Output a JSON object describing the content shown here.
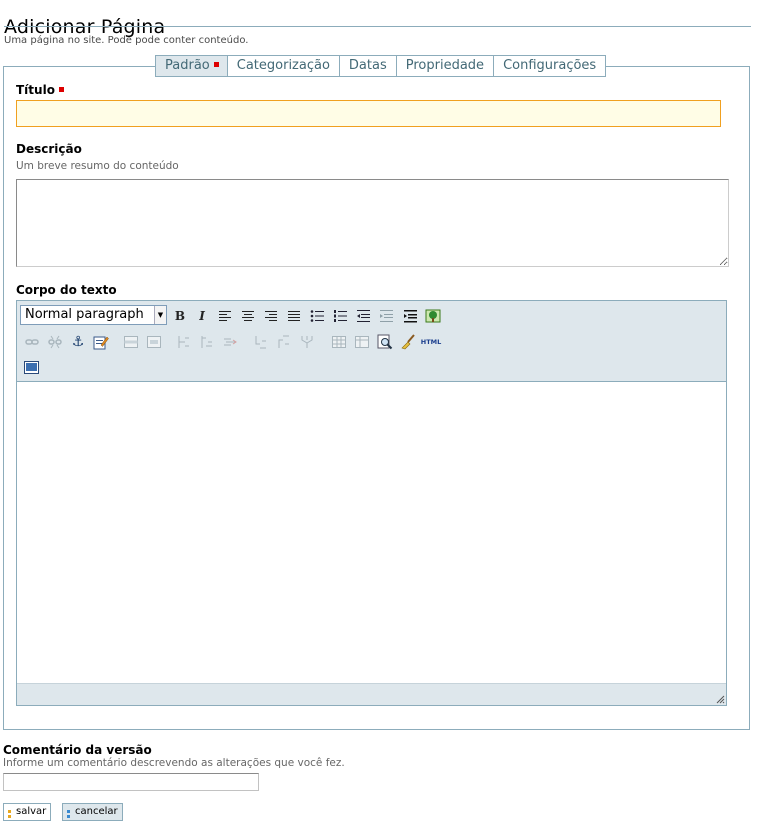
{
  "page": {
    "title": "Adicionar Página",
    "description": "Uma página no site. Pode pode conter conteúdo."
  },
  "tabs": [
    {
      "label": "Padrão",
      "active": true
    },
    {
      "label": "Categorização"
    },
    {
      "label": "Datas"
    },
    {
      "label": "Propriedade"
    },
    {
      "label": "Configurações"
    }
  ],
  "fields": {
    "title": {
      "label": "Título",
      "value": ""
    },
    "description": {
      "label": "Descrição",
      "help": "Um breve resumo do conteúdo",
      "value": ""
    },
    "body": {
      "label": "Corpo do texto",
      "format_selected": "Normal paragraph",
      "value": ""
    }
  },
  "toolbar": {
    "row1": [
      "bold",
      "italic",
      "align-left",
      "align-center",
      "align-right",
      "align-justify",
      "unordered-list",
      "ordered-list",
      "outdent",
      "indent",
      "image"
    ],
    "row2": [
      "link",
      "unlink",
      "anchor",
      "edit-link",
      "table-row-insert",
      "table-row-delete",
      "col-insert-before",
      "col-insert-after",
      "col-delete",
      "cell-split",
      "cell-merge",
      "cell-props",
      "table",
      "table-props",
      "zoom-find",
      "cleanup",
      "html"
    ],
    "row3": [
      "fullscreen"
    ],
    "html_label": "HTML",
    "bold_glyph": "B",
    "italic_glyph": "I"
  },
  "version_comment": {
    "label": "Comentário da versão",
    "help": "Informe um comentário descrevendo as alterações que você fez.",
    "value": ""
  },
  "buttons": {
    "save": "salvar",
    "cancel": "cancelar"
  },
  "colors": {
    "border": "#8cacbb",
    "tab_active_bg": "#dee7ec",
    "required": "#dd0000",
    "title_input_border": "#f0a020"
  }
}
